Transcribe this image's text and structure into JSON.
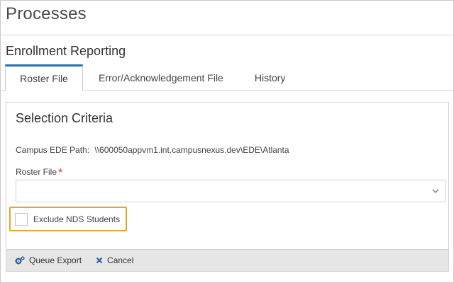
{
  "page": {
    "title": "Processes"
  },
  "section": {
    "title": "Enrollment Reporting"
  },
  "tabs": [
    {
      "label": "Roster File",
      "active": true
    },
    {
      "label": "Error/Acknowledgement File",
      "active": false
    },
    {
      "label": "History",
      "active": false
    }
  ],
  "panel": {
    "title": "Selection Criteria",
    "campus_path_label": "Campus EDE Path:",
    "campus_path_value": "\\\\600050appvm1.int.campusnexus.dev\\EDE\\Atlanta",
    "roster_file_label": "Roster File",
    "required_mark": "*",
    "roster_file_value": "",
    "exclude_nds_label": "Exclude NDS Students",
    "exclude_nds_checked": false
  },
  "footer": {
    "queue_export_label": "Queue Export",
    "cancel_label": "Cancel"
  },
  "colors": {
    "accent": "#1f6fb5",
    "highlight": "#e0a92c",
    "required": "#d9302c",
    "footer_bg": "#e6e6e6"
  },
  "icons": {
    "queue_export": "gears-icon",
    "cancel": "x-icon",
    "dropdown": "chevron-down-icon"
  }
}
